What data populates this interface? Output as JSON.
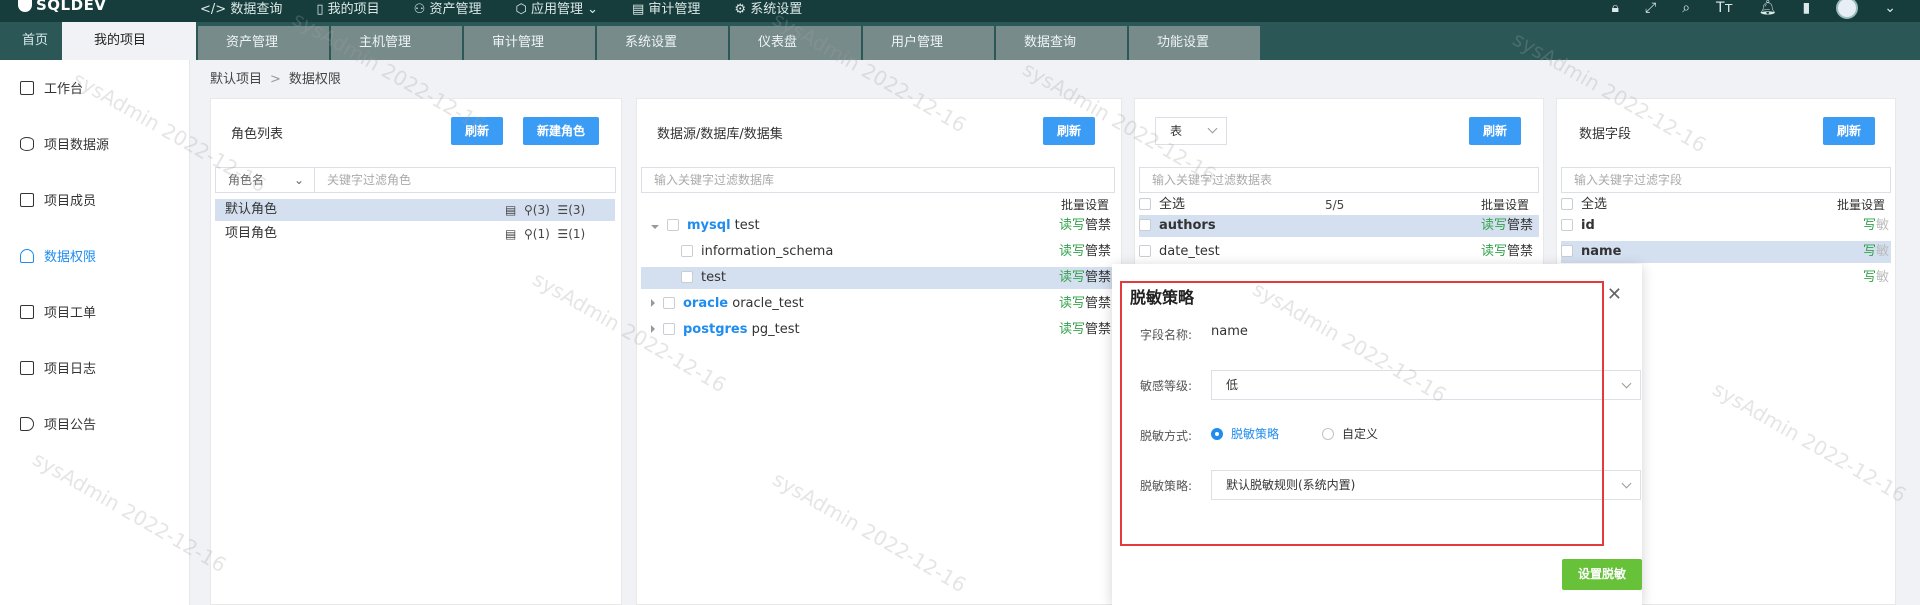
{
  "app": {
    "logo_text": "SQLDEV"
  },
  "topnav": {
    "items": [
      {
        "icon": "code-icon",
        "label": "数据查询"
      },
      {
        "icon": "book-icon",
        "label": "我的项目"
      },
      {
        "icon": "assets-icon",
        "label": "资产管理"
      },
      {
        "icon": "cube-icon",
        "label": "应用管理"
      },
      {
        "icon": "audit-icon",
        "label": "审计管理"
      },
      {
        "icon": "gear-icon",
        "label": "系统设置"
      }
    ],
    "right_icons": [
      "lock-icon",
      "fullscreen-icon",
      "search-icon",
      "font-size-icon",
      "bell-icon",
      "doc-icon",
      "avatar"
    ]
  },
  "tabs": {
    "home": "首页",
    "my_project": "我的项目",
    "sub": [
      "资产管理",
      "主机管理",
      "审计管理",
      "系统设置",
      "仪表盘",
      "用户管理",
      "数据查询",
      "功能设置"
    ]
  },
  "sidebar": {
    "items": [
      {
        "label": "工作台",
        "icon": "dashboard-icon"
      },
      {
        "label": "项目数据源",
        "icon": "database-icon"
      },
      {
        "label": "项目成员",
        "icon": "members-icon"
      },
      {
        "label": "数据权限",
        "icon": "user-icon",
        "active": true
      },
      {
        "label": "项目工单",
        "icon": "ticket-icon"
      },
      {
        "label": "项目日志",
        "icon": "log-icon"
      },
      {
        "label": "项目公告",
        "icon": "announce-icon"
      }
    ]
  },
  "breadcrumb": {
    "root": "默认项目",
    "current": "数据权限"
  },
  "roles_panel": {
    "title": "角色列表",
    "refresh": "刷新",
    "new_role": "新建角色",
    "filter_select": "角色名",
    "filter_placeholder": "关键字过滤角色",
    "rows": [
      {
        "name": "默认角色",
        "users": "(3)",
        "dbs": "(3)"
      },
      {
        "name": "项目角色",
        "users": "(1)",
        "dbs": "(1)"
      }
    ]
  },
  "ds_panel": {
    "title": "数据源/数据库/数据集",
    "refresh": "刷新",
    "placeholder": "输入关键字过滤数据库",
    "batch": "批量设置",
    "perm_rw": "读写",
    "perm_admin": "管禁",
    "rows": [
      {
        "type": "mysql",
        "name": "test"
      },
      {
        "name": "information_schema"
      },
      {
        "name": "test"
      },
      {
        "type": "oracle",
        "name": "oracle_test"
      },
      {
        "type": "postgres",
        "name": "pg_test"
      }
    ]
  },
  "table_panel": {
    "select_value": "表",
    "refresh": "刷新",
    "placeholder": "输入关键字过滤数据表",
    "select_all": "全选",
    "count": "5/5",
    "batch": "批量设置",
    "perm_rw": "读写",
    "perm_admin": "管禁",
    "rows": [
      "authors",
      "date_test"
    ]
  },
  "field_panel": {
    "title": "数据字段",
    "refresh": "刷新",
    "placeholder": "输入关键字过滤字段",
    "select_all": "全选",
    "batch": "批量设置",
    "perm_w": "写",
    "perm_off": "敏",
    "rows": [
      "id",
      "name"
    ]
  },
  "dialog": {
    "title": "脱敏策略",
    "field_label": "字段名称:",
    "field_value": "name",
    "level_label": "敏感等级:",
    "level_value": "低",
    "method_label": "脱敏方式:",
    "method_opt1": "脱敏策略",
    "method_opt2": "自定义",
    "policy_label": "脱敏策略:",
    "policy_value": "默认脱敏规则(系统内置)",
    "submit": "设置脱敏"
  },
  "watermark": "sysAdmin 2022-12-16"
}
